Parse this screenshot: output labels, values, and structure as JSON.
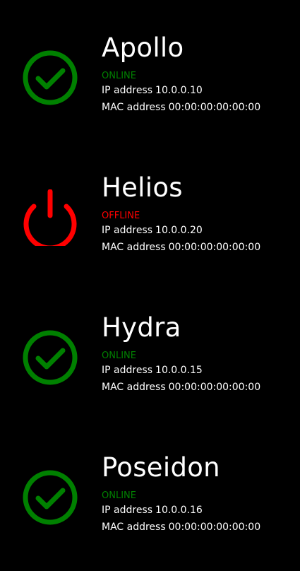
{
  "colors": {
    "background": "#000000",
    "text": "#ffffff",
    "online": "#008000",
    "offline": "#ff0000"
  },
  "labels": {
    "ip": "IP address",
    "mac": "MAC address"
  },
  "servers": [
    {
      "name": "Apollo",
      "status": "ONLINE",
      "state": "online",
      "icon": "check-circle-icon",
      "ip": "10.0.0.10",
      "mac": "00:00:00:00:00:00"
    },
    {
      "name": "Helios",
      "status": "OFFLINE",
      "state": "offline",
      "icon": "power-icon",
      "ip": "10.0.0.20",
      "mac": "00:00:00:00:00:00"
    },
    {
      "name": "Hydra",
      "status": "ONLINE",
      "state": "online",
      "icon": "check-circle-icon",
      "ip": "10.0.0.15",
      "mac": "00:00:00:00:00:00"
    },
    {
      "name": "Poseidon",
      "status": "ONLINE",
      "state": "online",
      "icon": "check-circle-icon",
      "ip": "10.0.0.16",
      "mac": "00:00:00:00:00:00"
    }
  ]
}
